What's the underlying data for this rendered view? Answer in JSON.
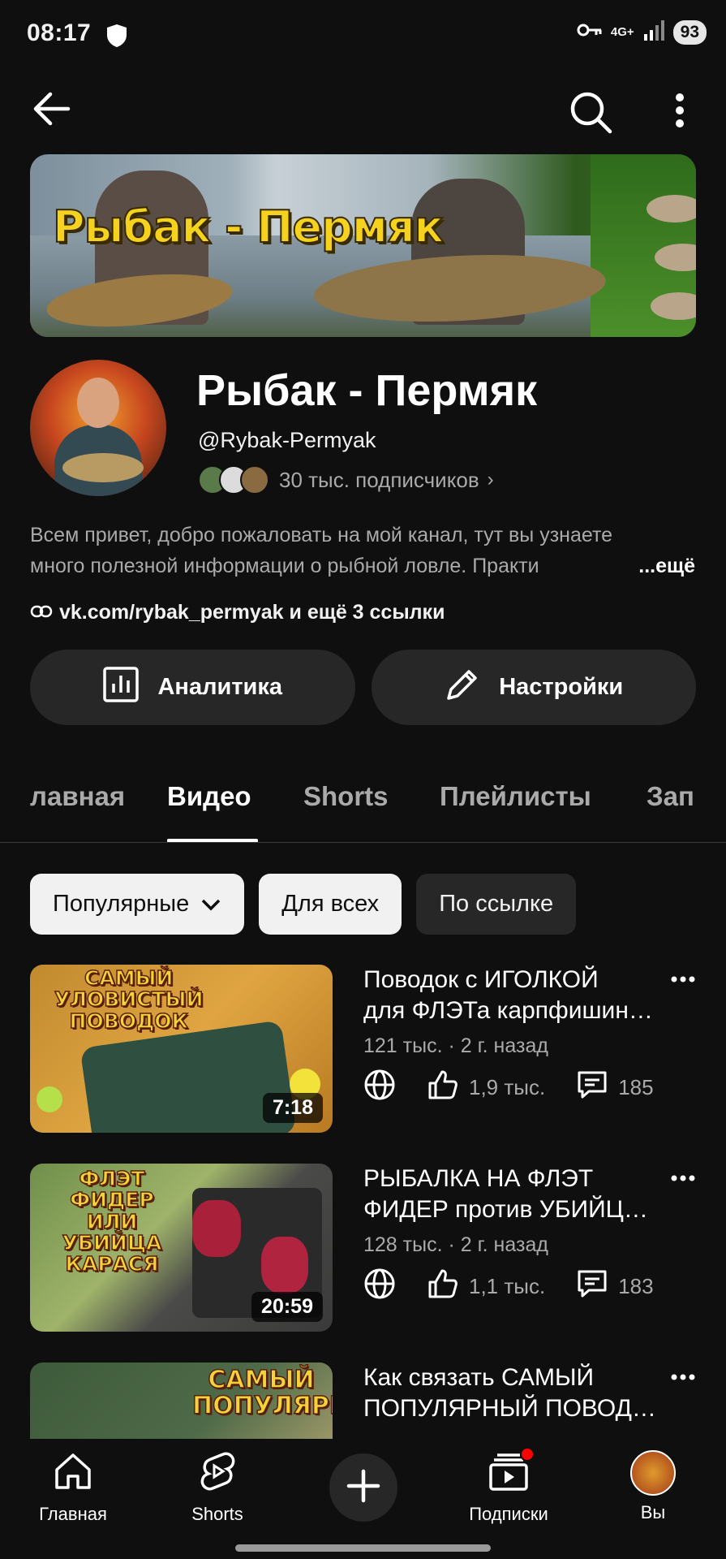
{
  "status_bar": {
    "time": "08:17",
    "network": "4G+",
    "battery": "93"
  },
  "icons": {
    "back": "arrow-left-icon",
    "search": "search-icon",
    "more": "more-vertical-icon",
    "link": "link-icon",
    "analytics": "analytics-icon",
    "edit": "pencil-icon",
    "dropdown": "chevron-down-icon",
    "globe": "globe-icon",
    "like": "thumbs-up-icon",
    "comment": "comment-icon",
    "home": "home-icon",
    "shorts": "shorts-icon",
    "create": "plus-icon",
    "subscriptions": "subscriptions-icon"
  },
  "banner": {
    "title": "Рыбак - Пермяк"
  },
  "channel": {
    "name": "Рыбак - Пермяк",
    "handle": "@Rybak-Permyak",
    "subscribers": "30 тыс. подписчиков",
    "description_line1": "Всем привет, добро пожаловать на мой канал, тут вы узнаете",
    "description_line2": "много полезной информации о рыбной ловле. Практи",
    "more_label": "...ещё",
    "links": "vk.com/rybak_permyak и ещё 3 ссылки"
  },
  "buttons": {
    "analytics": "Аналитика",
    "settings": "Настройки"
  },
  "tabs": [
    {
      "label": "лавная"
    },
    {
      "label": "Видео"
    },
    {
      "label": "Shorts"
    },
    {
      "label": "Плейлисты"
    },
    {
      "label": "Зап"
    }
  ],
  "chips": {
    "sort": "Популярные",
    "public": "Для всех",
    "unlisted": "По ссылке"
  },
  "videos": [
    {
      "title_line1": "Поводок с ИГОЛКОЙ",
      "title_line2": "для ФЛЭТа карпфишин…",
      "meta": "121 тыс. · 2 г. назад",
      "likes": "1,9 тыс.",
      "comments": "185",
      "duration": "7:18",
      "thumb_text_1": "САМЫЙ",
      "thumb_text_2": "УЛОВИСТЫЙ",
      "thumb_text_3": "ПОВОДОК"
    },
    {
      "title_line1": "РЫБАЛКА НА ФЛЭТ",
      "title_line2": "ФИДЕР против УБИЙЦ…",
      "meta": "128 тыс. · 2 г. назад",
      "likes": "1,1 тыс.",
      "comments": "183",
      "duration": "20:59",
      "thumb_text_1": "ФЛЭТ ФИДЕР",
      "thumb_text_2": "ИЛИ",
      "thumb_text_3": "УБИЙЦА",
      "thumb_text_4": "КАРАСЯ"
    },
    {
      "title_line1": "Как связать САМЫЙ",
      "title_line2": "ПОПУЛЯРНЫЙ ПОВОД…",
      "thumb_text_1": "САМЫЙ",
      "thumb_text_2": "ПОПУЛЯРНЫЙ"
    }
  ],
  "bottom_nav": {
    "home": "Главная",
    "shorts": "Shorts",
    "subscriptions": "Подписки",
    "you": "Вы"
  },
  "colors": {
    "background": "#0f0f0f",
    "surface": "#272727",
    "notification_dot": "#ff0000"
  }
}
